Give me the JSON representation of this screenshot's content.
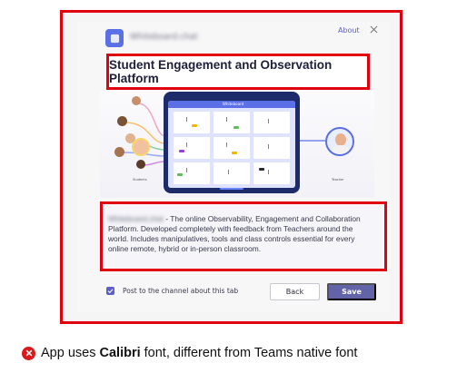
{
  "dialog": {
    "app_name": "Whiteboard.chat",
    "about_link": "About",
    "title": "Student Engagement and Observation Platform",
    "illustration": {
      "tablet_brand": "Whiteboard",
      "student_label": "Students",
      "teacher_label": "Teacher"
    },
    "description": {
      "blurred_name": "Whiteboard.chat",
      "text": " - The online Observability, Engagement and Collaboration Platform. Developed completely with feedback from Teachers around the world. Includes manipulatives, tools and class controls essential for every online remote, hybrid or in-person classroom."
    },
    "post_checkbox": {
      "checked": true,
      "label": "Post to the channel about this tab"
    },
    "back_button": "Back",
    "save_button": "Save"
  },
  "annotation": {
    "prefix": "App uses ",
    "bold_word": "Calibri",
    "suffix": " font, different from Teams native font"
  },
  "colors": {
    "highlight_border": "#e00010",
    "accent": "#6264a7",
    "error": "#d91a1a"
  }
}
